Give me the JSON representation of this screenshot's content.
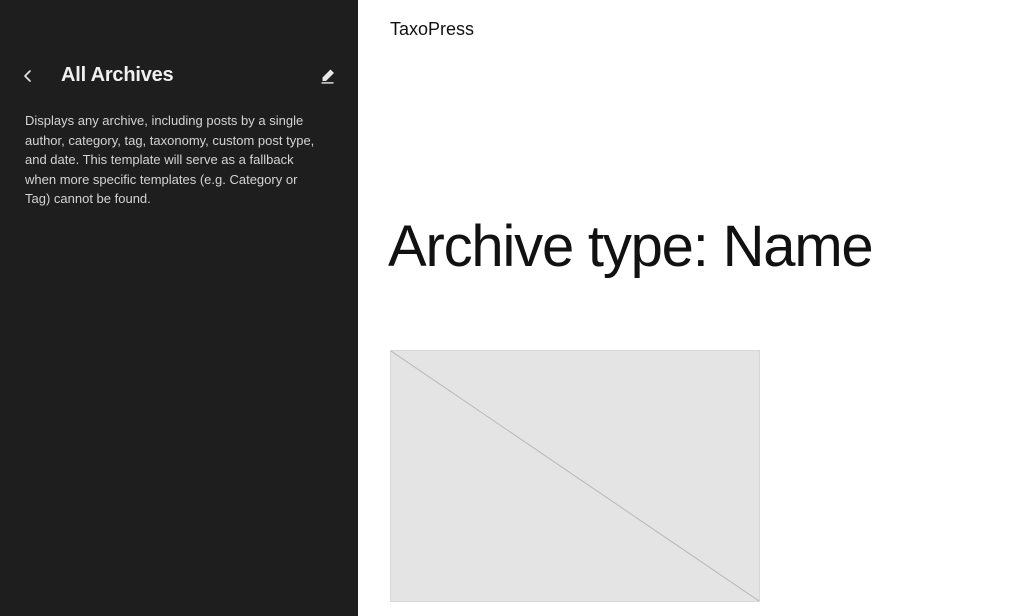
{
  "sidebar": {
    "title": "All Archives",
    "description": "Displays any archive, including posts by a single author, category, tag, taxonomy, custom post type, and date. This template will serve as a fallback when more specific templates (e.g. Category or Tag) cannot be found.",
    "back_icon": "chevron-left-icon",
    "edit_icon": "pencil-icon"
  },
  "canvas": {
    "site_title": "TaxoPress",
    "archive_heading": "Archive type: Name"
  },
  "colors": {
    "sidebar_bg": "#1e1e1e",
    "canvas_bg": "#ffffff",
    "placeholder_bg": "#e4e4e4"
  }
}
